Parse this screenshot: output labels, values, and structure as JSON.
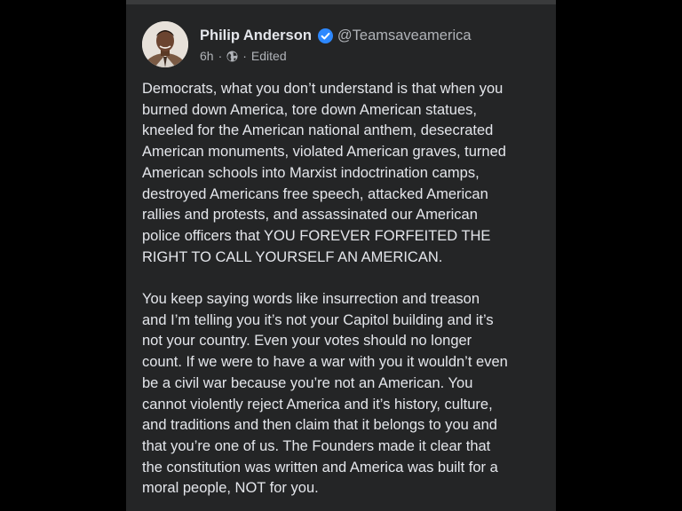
{
  "post": {
    "author": {
      "name": "Philip Anderson",
      "handle": "@Teamsaveamerica",
      "verified": true,
      "avatar_icon": "avatar-photo"
    },
    "meta": {
      "time": "6h",
      "separator": "·",
      "audience_icon": "globe-icon",
      "edited_label": "Edited"
    },
    "paragraphs": [
      "Democrats, what you don’t understand is that when you\nburned down America, tore down American statues,\nkneeled for the American national anthem, desecrated\nAmerican monuments, violated American graves, turned\nAmerican schools into Marxist indoctrination camps,\ndestroyed Americans free speech, attacked American\nrallies and protests, and assassinated our American\npolice officers that YOU FOREVER FORFEITED THE\nRIGHT TO CALL YOURSELF AN AMERICAN.",
      "You keep saying words like insurrection and treason\nand I’m telling you it’s not your Capitol building and it’s\nnot your country. Even your votes should no longer\ncount. If we were to have a war with you it wouldn’t even\nbe a civil war because you’re not an American. You\ncannot violently reject America and it’s history, culture,\nand traditions and then claim that it belongs to you and\nthat you’re one of us. The Founders made it clear that\nthe constitution was written and America was built for a\nmoral people, NOT for you."
    ]
  },
  "colors": {
    "page_background": "#000000",
    "card_background": "#242526",
    "primary_text": "#e4e6eb",
    "secondary_text": "#b0b3b8",
    "verified_badge": "#2d88ff"
  }
}
